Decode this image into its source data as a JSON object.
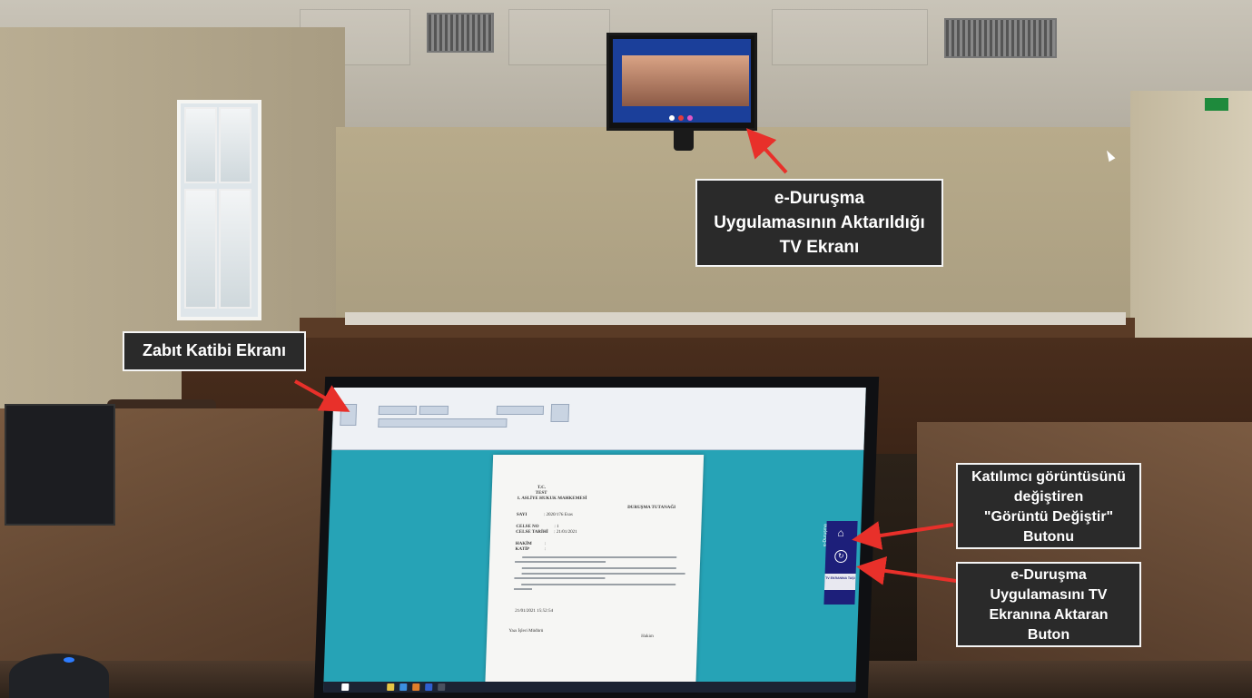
{
  "callouts": {
    "tv": {
      "lines": [
        "e-Duruşma",
        "Uygulamasının Aktarıldığı",
        "TV Ekranı"
      ]
    },
    "clerk": {
      "lines": [
        "Zabıt Katibi Ekranı"
      ]
    },
    "switch_view": {
      "lines": [
        "Katılımcı görüntüsünü",
        "değiştiren",
        "\"Görüntü Değiştir\"",
        "Butonu"
      ]
    },
    "transfer": {
      "lines": [
        "e-Duruşma",
        "Uygulamasını TV",
        "Ekranına Aktaran",
        "Buton"
      ]
    }
  },
  "side_panel": {
    "title": "e-Duruşma",
    "tv_button": "TV EKRANINA TAŞI"
  },
  "document": {
    "header_country": "T.C.",
    "header_test": "TEST",
    "header_court": "1. ASLİYE HUKUK MAHKEMESİ",
    "title": "DURUŞMA TUTANAĞI",
    "rows": [
      {
        "label": "SAYI",
        "value": ": 2020/176 Esas"
      },
      {
        "label": "CELSE NO",
        "value": ": 1"
      },
      {
        "label": "CELSE TARİHİ",
        "value": ": 21/01/2021"
      },
      {
        "label": "HAKİM",
        "value": ":"
      },
      {
        "label": "KATİP",
        "value": ":"
      }
    ],
    "date_line": "21/01/2021     15:52:54",
    "footer_left": "Yazı İşleri Müdürü",
    "footer_right": "Hakim"
  },
  "colors": {
    "callout_bg": "#2a2a2a",
    "callout_border": "#f4f4f4",
    "arrow": "#e8302a",
    "panel": "#1d1f7a",
    "desktop": "#26a3b6"
  }
}
